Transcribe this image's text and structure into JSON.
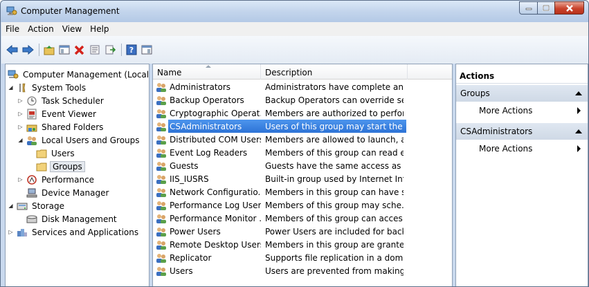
{
  "window": {
    "title": "Computer Management"
  },
  "menu": [
    "File",
    "Action",
    "View",
    "Help"
  ],
  "toolbar": [
    {
      "icon": "back-arrow-icon"
    },
    {
      "icon": "forward-arrow-icon"
    },
    {
      "icon": "up-folder-icon"
    },
    {
      "icon": "show-hide-tree-icon"
    },
    {
      "icon": "delete-icon"
    },
    {
      "icon": "properties-icon"
    },
    {
      "icon": "export-list-icon"
    },
    {
      "icon": "help-icon"
    },
    {
      "icon": "show-hide-action-pane-icon"
    }
  ],
  "tree": [
    {
      "label": "Computer Management (Local",
      "level": 0,
      "expander": "",
      "icon": "computer-management-icon"
    },
    {
      "label": "System Tools",
      "level": 1,
      "expander": "open",
      "icon": "tools-icon"
    },
    {
      "label": "Task Scheduler",
      "level": 2,
      "expander": "closed",
      "icon": "clock-icon"
    },
    {
      "label": "Event Viewer",
      "level": 2,
      "expander": "closed",
      "icon": "event-viewer-icon"
    },
    {
      "label": "Shared Folders",
      "level": 2,
      "expander": "closed",
      "icon": "shared-folder-icon"
    },
    {
      "label": "Local Users and Groups",
      "level": 2,
      "expander": "open",
      "icon": "users-icon"
    },
    {
      "label": "Users",
      "level": 3,
      "expander": "",
      "icon": "folder-icon"
    },
    {
      "label": "Groups",
      "level": 3,
      "expander": "",
      "icon": "folder-icon",
      "selected": true
    },
    {
      "label": "Performance",
      "level": 2,
      "expander": "closed",
      "icon": "performance-icon"
    },
    {
      "label": "Device Manager",
      "level": 2,
      "expander": "",
      "icon": "device-manager-icon"
    },
    {
      "label": "Storage",
      "level": 1,
      "expander": "open",
      "icon": "storage-icon"
    },
    {
      "label": "Disk Management",
      "level": 2,
      "expander": "",
      "icon": "disk-icon"
    },
    {
      "label": "Services and Applications",
      "level": 1,
      "expander": "closed",
      "icon": "services-icon"
    }
  ],
  "list": {
    "columns": {
      "name": "Name",
      "description": "Description"
    },
    "rows": [
      {
        "name": "Administrators",
        "description": "Administrators have complete an..."
      },
      {
        "name": "Backup Operators",
        "description": "Backup Operators can override se..."
      },
      {
        "name": "Cryptographic Operat...",
        "description": "Members are authorized to perfor..."
      },
      {
        "name": "CSAdministrators",
        "description": "Users of this group may start the ...",
        "selected": true
      },
      {
        "name": "Distributed COM Users",
        "description": "Members are allowed to launch, a..."
      },
      {
        "name": "Event Log Readers",
        "description": "Members of this group can read e..."
      },
      {
        "name": "Guests",
        "description": "Guests have the same access as m..."
      },
      {
        "name": "IIS_IUSRS",
        "description": "Built-in group used by Internet Inf..."
      },
      {
        "name": "Network Configuratio...",
        "description": "Members in this group can have s..."
      },
      {
        "name": "Performance Log Users",
        "description": "Members of this group may sche..."
      },
      {
        "name": "Performance Monitor ...",
        "description": "Members of this group can acces..."
      },
      {
        "name": "Power Users",
        "description": "Power Users are included for back..."
      },
      {
        "name": "Remote Desktop Users",
        "description": "Members in this group are grante..."
      },
      {
        "name": "Replicator",
        "description": "Supports file replication in a dom..."
      },
      {
        "name": "Users",
        "description": "Users are prevented from making ..."
      }
    ]
  },
  "actions": {
    "title": "Actions",
    "sections": [
      {
        "header": "Groups",
        "item": "More Actions"
      },
      {
        "header": "CSAdministrators",
        "item": "More Actions"
      }
    ]
  },
  "colors": {
    "selection": "#3c86e6",
    "window_frame": "#c9d9ee"
  }
}
